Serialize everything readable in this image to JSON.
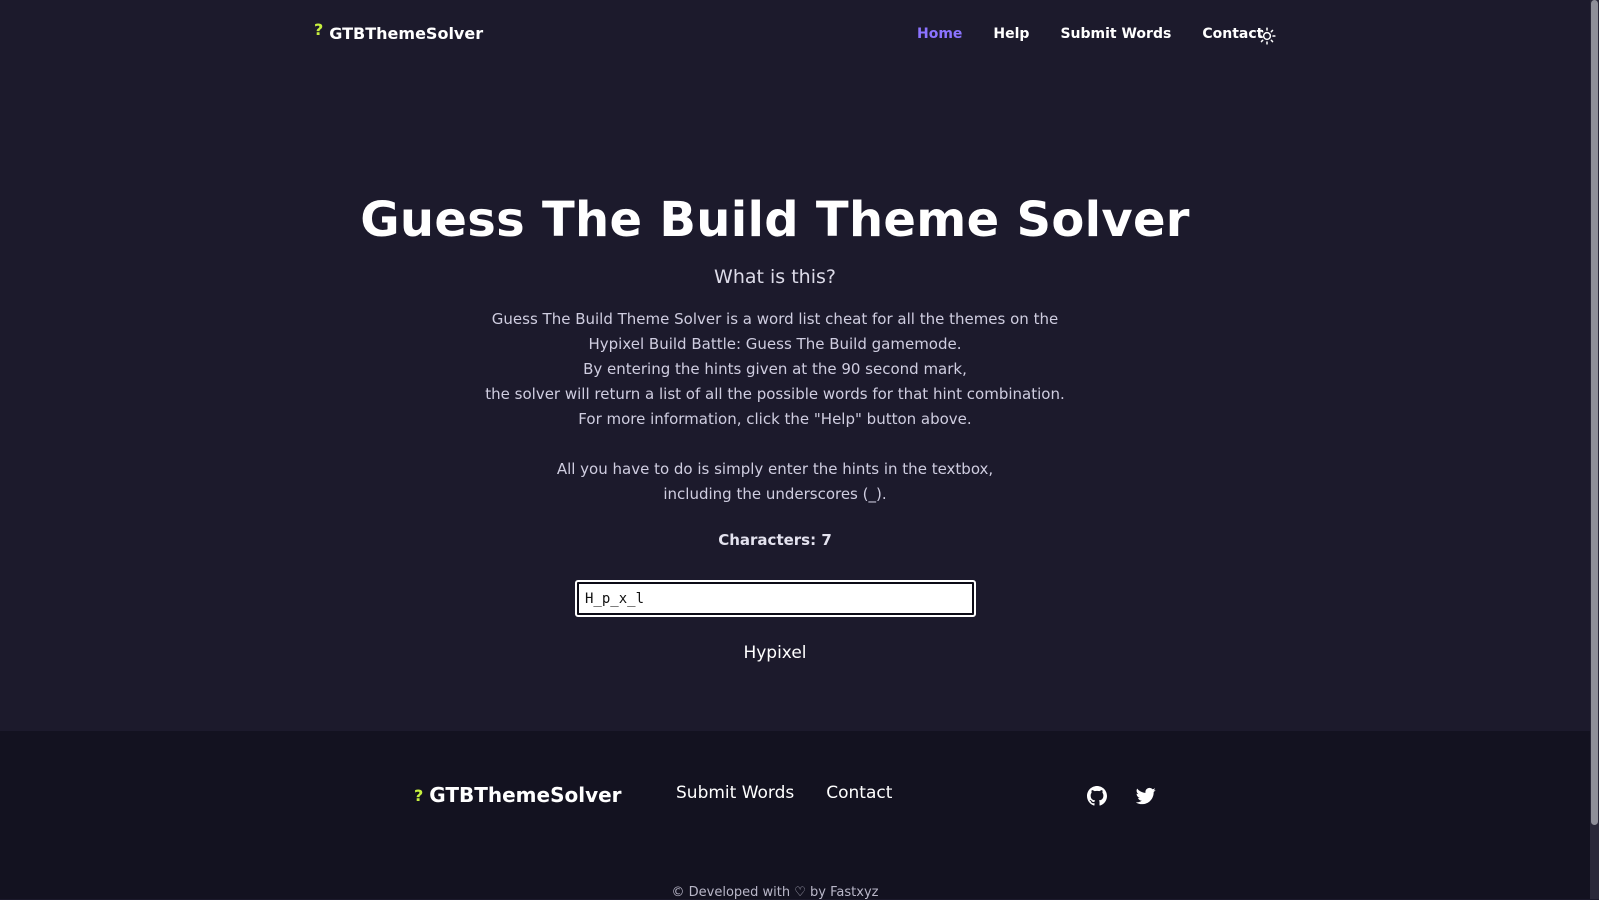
{
  "nav": {
    "brand_mark": "?",
    "brand_name": "GTBThemeSolver",
    "links": [
      {
        "label": "Home",
        "active": true
      },
      {
        "label": "Help",
        "active": false
      },
      {
        "label": "Submit Words",
        "active": false
      },
      {
        "label": "Contact",
        "active": false
      }
    ],
    "theme_icon": "sun-icon"
  },
  "hero": {
    "title": "Guess The Build Theme Solver",
    "subtitle": "What is this?",
    "description_lines": [
      "Guess The Build Theme Solver is a word list cheat for all the themes on the",
      "Hypixel Build Battle: Guess The Build gamemode.",
      "By entering the hints given at the 90 second mark,",
      "the solver will return a list of all the possible words for that hint combination.",
      "For more information, click the \"Help\" button above."
    ],
    "instruction_lines": [
      "All you have to do is simply enter the hints in the textbox,",
      "including the underscores (_)."
    ],
    "characters_label": "Characters: 7"
  },
  "solver": {
    "input_value": "H_p_x_l",
    "results": [
      "Hypixel"
    ]
  },
  "footer": {
    "brand_mark": "?",
    "brand_name": "GTBThemeSolver",
    "links": [
      "Submit Words",
      "Contact"
    ],
    "icons": [
      "github-icon",
      "twitter-icon"
    ],
    "copyright": "© Developed with ♡ by Fastxyz"
  },
  "colors": {
    "background": "#1c1a2c",
    "footer_background": "#131220",
    "accent": "#8b73ff",
    "brand_mark": "#c6ef3f"
  }
}
